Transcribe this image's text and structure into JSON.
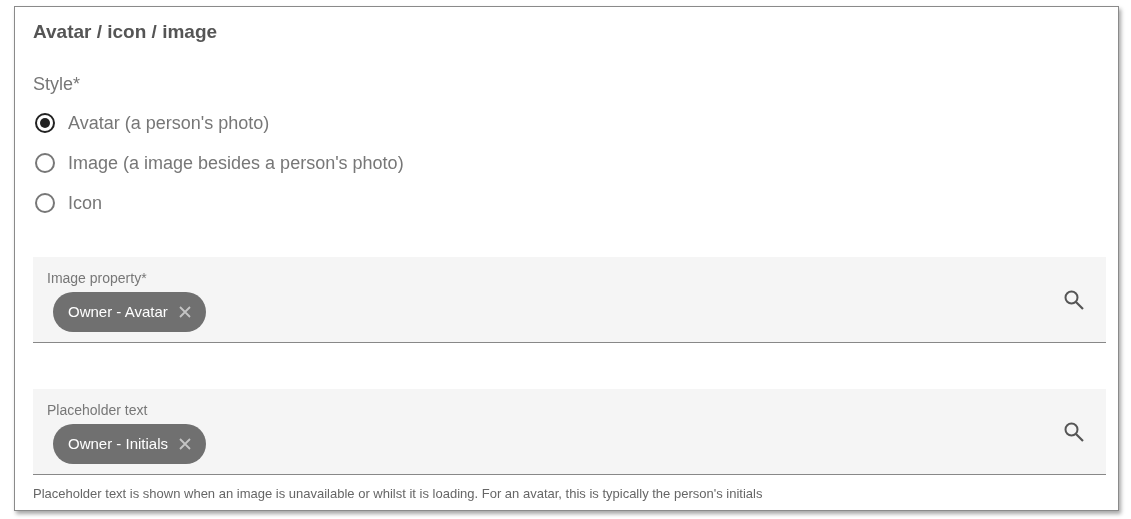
{
  "section": {
    "title": "Avatar / icon / image"
  },
  "style_group": {
    "label": "Style*",
    "options": [
      {
        "label": "Avatar (a person's photo)",
        "selected": true
      },
      {
        "label": "Image (a image besides a person's photo)",
        "selected": false
      },
      {
        "label": "Icon",
        "selected": false
      }
    ]
  },
  "fields": [
    {
      "label": "Image property*",
      "chips": [
        "Owner - Avatar"
      ]
    },
    {
      "label": "Placeholder text",
      "chips": [
        "Owner - Initials"
      ],
      "hint": "Placeholder text is shown when an image is unavailable or whilst it is loading. For an avatar, this is typically the person's initials"
    }
  ]
}
